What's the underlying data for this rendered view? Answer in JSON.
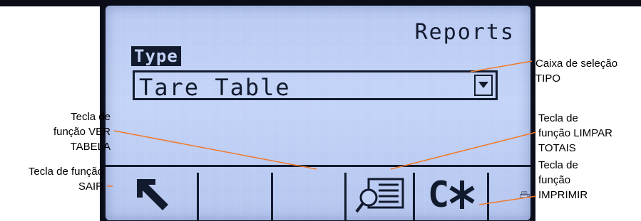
{
  "screen": {
    "title": "Reports",
    "type_label": "Type",
    "select": {
      "value": "Tare Table"
    }
  },
  "softkeys": [
    {
      "icon": "exit-arrow-icon"
    },
    {
      "icon": "blank"
    },
    {
      "icon": "blank"
    },
    {
      "icon": "view-table-icon"
    },
    {
      "icon": "clear-totals-icon",
      "text": "C"
    },
    {
      "icon": "printer-icon"
    }
  ],
  "callouts": {
    "type_box": [
      "Caixa de seleção",
      "TIPO"
    ],
    "view_table": [
      "Tecla de",
      "função VER",
      "TABELA"
    ],
    "exit": [
      "Tecla de função",
      "SAIR"
    ],
    "clear_totals": [
      "Tecla de",
      "função LIMPAR",
      "TOTAIS"
    ],
    "print": [
      "Tecla de",
      "função",
      "IMPRIMIR"
    ]
  },
  "colors": {
    "lcd_background": "#c2d2f7",
    "lcd_pixels": "#121a2e",
    "callout_line": "#f07a2a"
  }
}
